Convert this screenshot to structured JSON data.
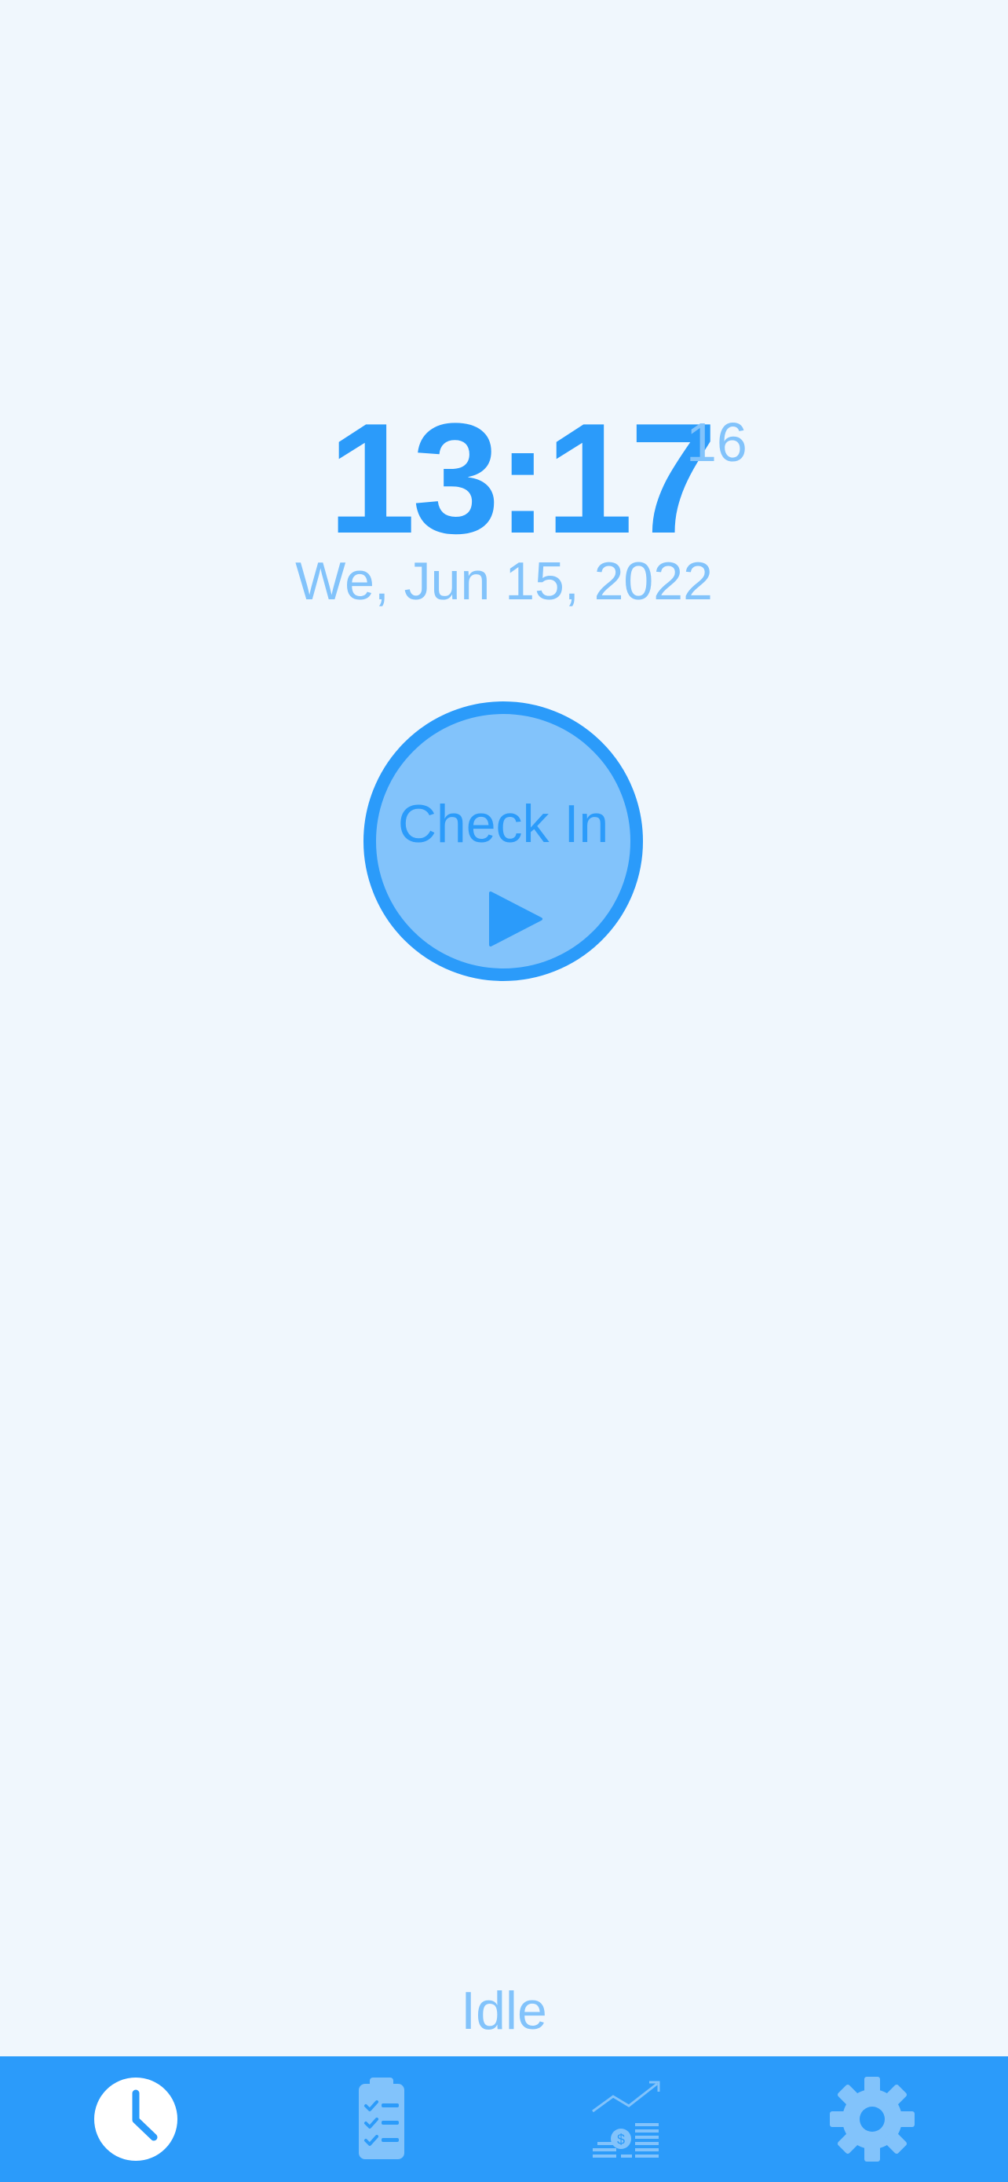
{
  "clock": {
    "time": "13:17",
    "seconds": "16",
    "date": "We, Jun 15, 2022"
  },
  "check_button": {
    "label": "Check In",
    "icon": "play-icon"
  },
  "status": "Idle",
  "nav": {
    "items": [
      {
        "icon": "clock-icon",
        "active": true
      },
      {
        "icon": "clipboard-checklist-icon",
        "active": false
      },
      {
        "icon": "earnings-chart-icon",
        "active": false
      },
      {
        "icon": "gear-icon",
        "active": false
      }
    ]
  },
  "colors": {
    "background": "#f0f7fd",
    "primary": "#2b9bfa",
    "secondary": "#82c3fb",
    "white": "#ffffff"
  }
}
